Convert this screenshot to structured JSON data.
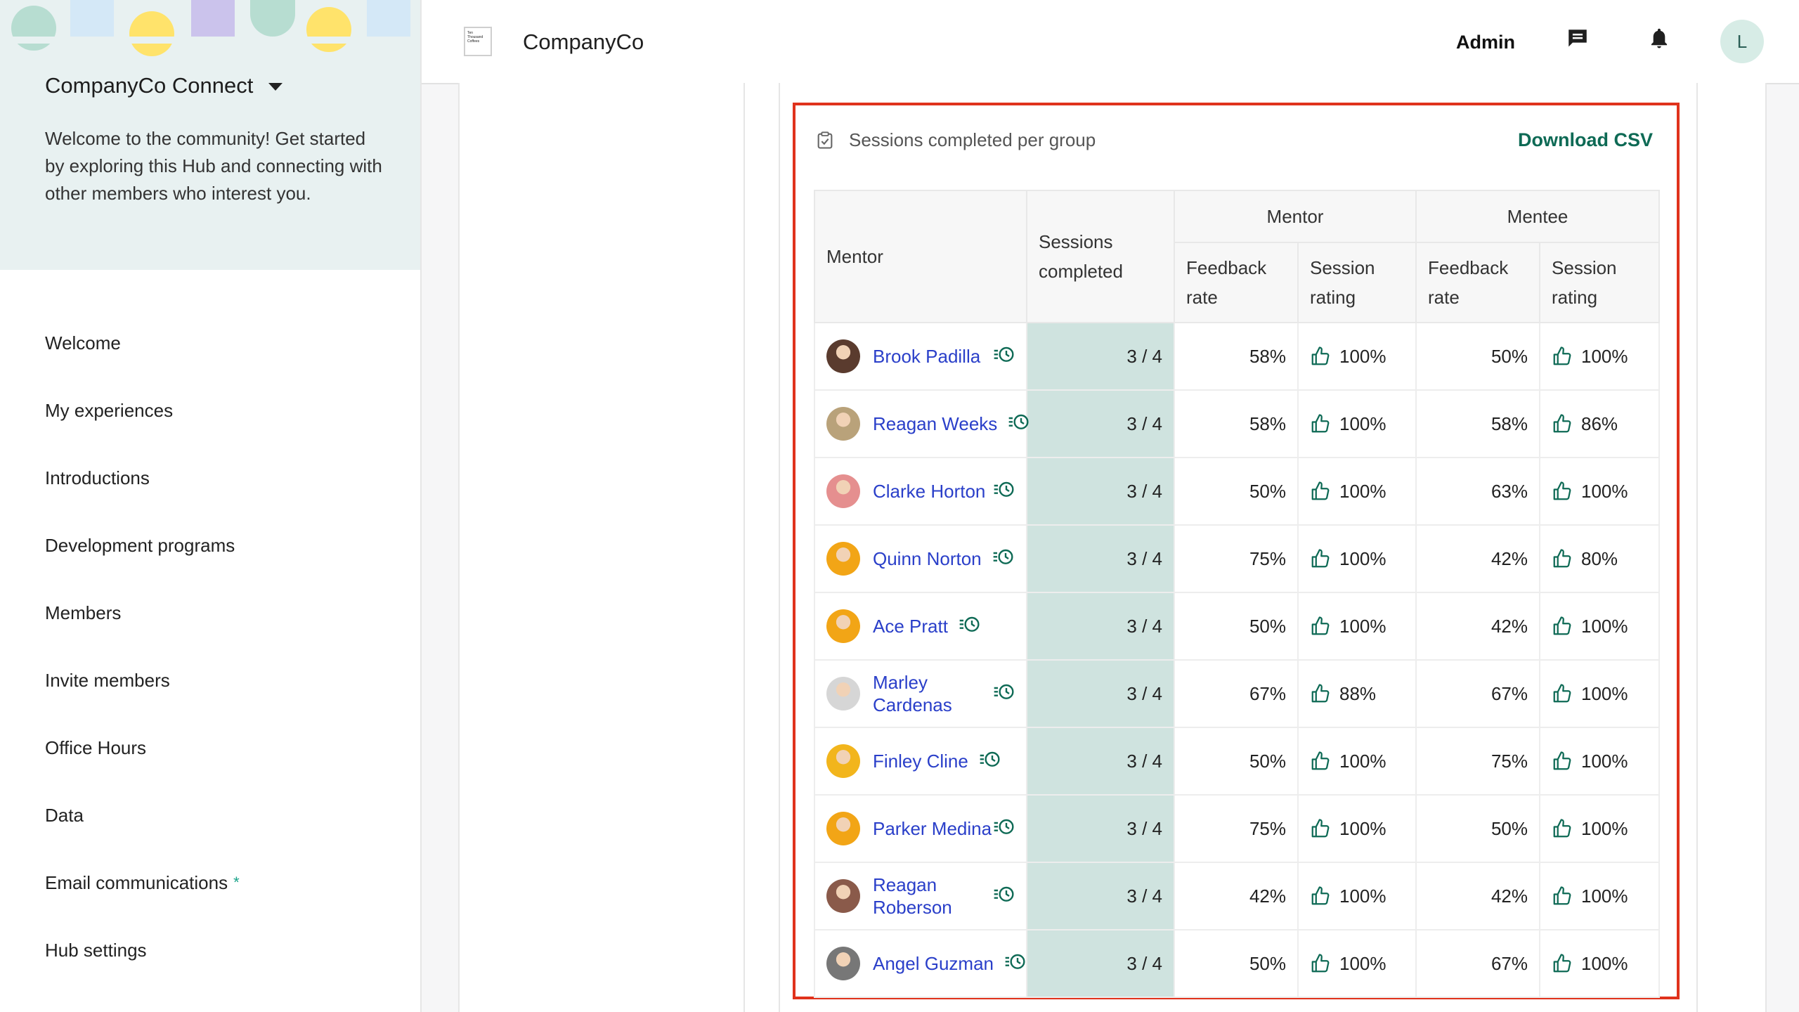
{
  "sidebar": {
    "hub_name": "CompanyCo Connect",
    "description": "Welcome to the community! Get started by exploring this Hub and connecting with other members who interest you.",
    "nav": [
      {
        "label": "Welcome",
        "badge": ""
      },
      {
        "label": "My experiences",
        "badge": ""
      },
      {
        "label": "Introductions",
        "badge": ""
      },
      {
        "label": "Development programs",
        "badge": ""
      },
      {
        "label": "Members",
        "badge": ""
      },
      {
        "label": "Invite members",
        "badge": ""
      },
      {
        "label": "Office Hours",
        "badge": ""
      },
      {
        "label": "Data",
        "badge": ""
      },
      {
        "label": "Email communications",
        "badge": "*"
      },
      {
        "label": "Hub settings",
        "badge": ""
      }
    ]
  },
  "topbar": {
    "logo_text": "Ten Thousand Coffees",
    "company": "CompanyCo",
    "admin_label": "Admin",
    "avatar_initial": "L",
    "icons": [
      "message-icon",
      "bell-icon"
    ]
  },
  "panel": {
    "title": "Sessions completed per group",
    "download_label": "Download CSV",
    "headers": {
      "mentor": "Mentor",
      "sessions": "Sessions completed",
      "group_mentor": "Mentor",
      "group_mentee": "Mentee",
      "feedback_rate": "Feedback rate",
      "session_rating": "Session rating"
    },
    "rows": [
      {
        "name": "Brook Padilla",
        "sessions": "3 / 4",
        "mentor_feedback": "58%",
        "mentor_rating": "100%",
        "mentee_feedback": "50%",
        "mentee_rating": "100%",
        "avatar_color": "#5a3b2e"
      },
      {
        "name": "Reagan Weeks",
        "sessions": "3 / 4",
        "mentor_feedback": "58%",
        "mentor_rating": "100%",
        "mentee_feedback": "58%",
        "mentee_rating": "86%",
        "avatar_color": "#b9a27a"
      },
      {
        "name": "Clarke Horton",
        "sessions": "3 / 4",
        "mentor_feedback": "50%",
        "mentor_rating": "100%",
        "mentee_feedback": "63%",
        "mentee_rating": "100%",
        "avatar_color": "#e58f8f"
      },
      {
        "name": "Quinn Norton",
        "sessions": "3 / 4",
        "mentor_feedback": "75%",
        "mentor_rating": "100%",
        "mentee_feedback": "42%",
        "mentee_rating": "80%",
        "avatar_color": "#f2a516"
      },
      {
        "name": "Ace Pratt",
        "sessions": "3 / 4",
        "mentor_feedback": "50%",
        "mentor_rating": "100%",
        "mentee_feedback": "42%",
        "mentee_rating": "100%",
        "avatar_color": "#f2a516"
      },
      {
        "name": "Marley Cardenas",
        "sessions": "3 / 4",
        "mentor_feedback": "67%",
        "mentor_rating": "88%",
        "mentee_feedback": "67%",
        "mentee_rating": "100%",
        "avatar_color": "#d6d6d6"
      },
      {
        "name": "Finley Cline",
        "sessions": "3 / 4",
        "mentor_feedback": "50%",
        "mentor_rating": "100%",
        "mentee_feedback": "75%",
        "mentee_rating": "100%",
        "avatar_color": "#f2b51c"
      },
      {
        "name": "Parker Medina",
        "sessions": "3 / 4",
        "mentor_feedback": "75%",
        "mentor_rating": "100%",
        "mentee_feedback": "50%",
        "mentee_rating": "100%",
        "avatar_color": "#f2a516"
      },
      {
        "name": "Reagan Roberson",
        "sessions": "3 / 4",
        "mentor_feedback": "42%",
        "mentor_rating": "100%",
        "mentee_feedback": "42%",
        "mentee_rating": "100%",
        "avatar_color": "#8a5a4a"
      },
      {
        "name": "Angel Guzman",
        "sessions": "3 / 4",
        "mentor_feedback": "50%",
        "mentor_rating": "100%",
        "mentee_feedback": "67%",
        "mentee_rating": "100%",
        "avatar_color": "#777777"
      }
    ]
  },
  "colors": {
    "link": "#2a3fc9",
    "accent": "#0e6a55",
    "highlight_border": "#e0321c",
    "sessions_bg": "#cfe3df",
    "sidebar_header_bg": "#e8f1f1"
  }
}
